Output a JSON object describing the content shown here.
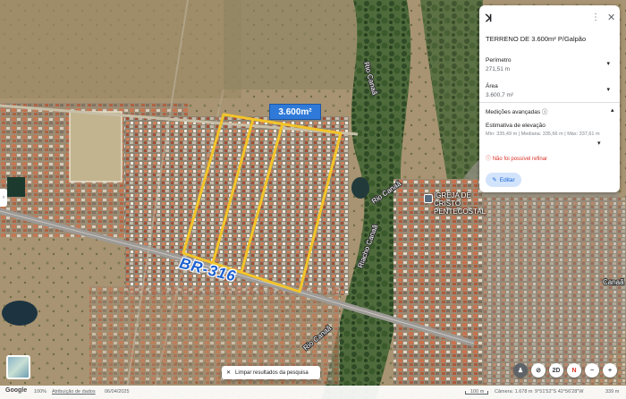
{
  "map": {
    "area_tag": "3.600m²",
    "road_label": "BR-316",
    "street_labels": {
      "top": "Rio Canaã",
      "mid": "Rio Canaã",
      "center": "Riacho Canaã",
      "bottom": "Rio Canaã"
    },
    "poi_name": "IGREJA DE CRISTO PENTECOSTAL",
    "right_edge_label": "Canaã"
  },
  "panel": {
    "logo": "ꓘ",
    "menu_icon": "⋮",
    "close_icon": "✕",
    "title": "TERRENO DE 3.600m² P/Galpão",
    "perimeter": {
      "label": "Perímetro",
      "value": "271,51 m"
    },
    "area": {
      "label": "Área",
      "value": "3.600,7 m²"
    },
    "advanced": {
      "label": "Medições avançadas"
    },
    "elevation": {
      "label": "Estimativa de elevação",
      "value": "Mín: 335,49 m | Mediana: 335,66 m | Máx: 337,61 m"
    },
    "warning": "Não foi possível refinar",
    "edit_label": "Editar"
  },
  "controls": {
    "clear_results": "Limpar resultados da pesquisa",
    "compass": "N",
    "mode_3d": "2D",
    "zoom_out": "−",
    "zoom_in": "+"
  },
  "statusbar": {
    "brand": "Google",
    "zoom": "100%",
    "attribution": "Atribuição de dados",
    "date": "06/04/2025",
    "scale": "100 m",
    "camera": "Câmera: 1.678 m",
    "coords": "9°51'52\"S 42°56'28\"W",
    "elevation": "339 m"
  },
  "colors": {
    "boundary": "#f2c42a",
    "accent": "#2f7ad8",
    "road_label": "#1a5fd0",
    "warning": "#d93025"
  }
}
